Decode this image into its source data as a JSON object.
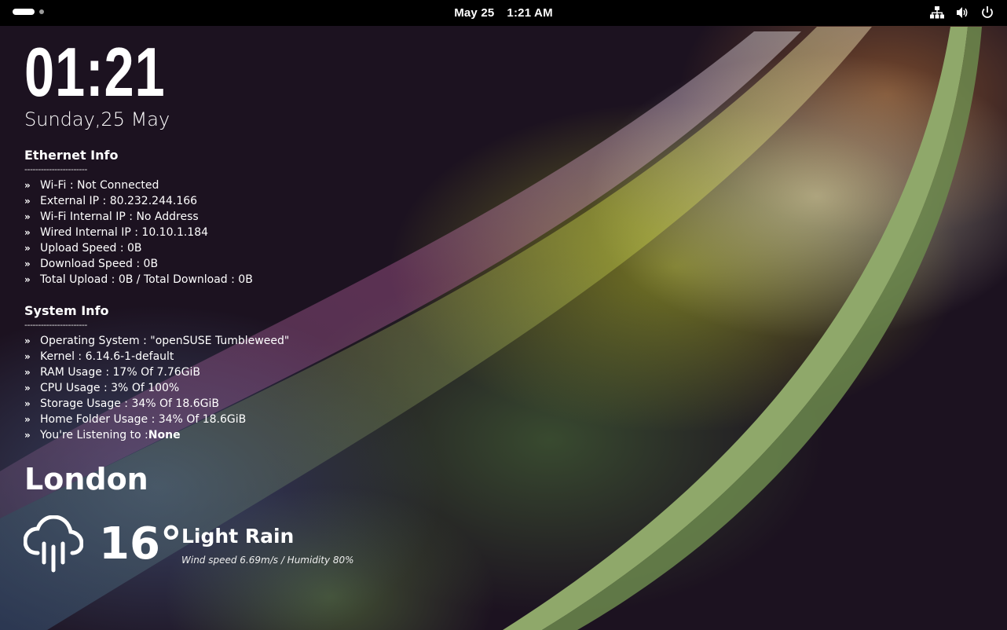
{
  "topbar": {
    "date": "May 25",
    "time": "1:21 AM",
    "icons": [
      "network-wired-icon",
      "volume-icon",
      "power-icon"
    ]
  },
  "clock": {
    "time": "01:21",
    "date": "Sunday,25 May"
  },
  "ethernet": {
    "title": "Ethernet Info",
    "divider": "-----------------------",
    "items": [
      "Wi-Fi : Not Connected",
      "External IP : 80.232.244.166",
      "Wi-Fi Internal IP : No Address",
      "Wired Internal IP : 10.10.1.184",
      "Upload Speed : 0B",
      "Download Speed : 0B",
      "Total Upload : 0B / Total Download : 0B"
    ]
  },
  "system": {
    "title": "System Info",
    "divider": "-----------------------",
    "items": [
      "Operating System : \"openSUSE Tumbleweed\"",
      "Kernel : 6.14.6-1-default",
      "RAM Usage : 17% Of 7.76GiB",
      "CPU Usage : 3% Of 100%",
      "Storage Usage : 34% Of 18.6GiB",
      "Home Folder Usage : 34% Of 18.6GiB"
    ],
    "listening_label": "You're Listening to : ",
    "listening_value": "None"
  },
  "weather": {
    "city": "London",
    "temperature": "16°",
    "condition": "Light Rain",
    "details": "Wind speed 6.69m/s / Humidity 80%",
    "icon": "cloud-rain-icon"
  },
  "colors": {
    "topbar": "#000000",
    "background": "#1c1220",
    "swoosh": "#8fa86a"
  }
}
